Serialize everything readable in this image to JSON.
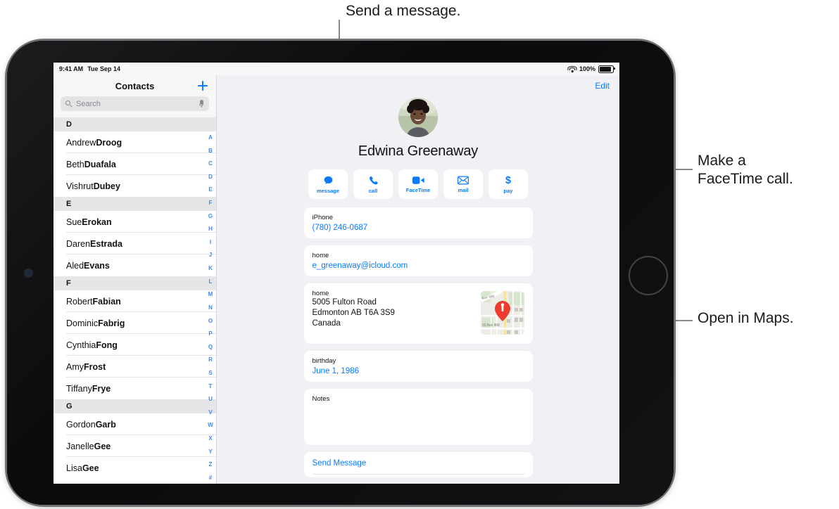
{
  "callouts": [
    {
      "id": "message",
      "text": "Send a message."
    },
    {
      "id": "facetime",
      "text": "Make a\nFaceTime call."
    },
    {
      "id": "maps",
      "text": "Open in Maps."
    }
  ],
  "status_bar": {
    "time": "9:41 AM",
    "date": "Tue Sep 14",
    "wifi_icon": "wifi-icon",
    "battery_percent": "100%",
    "battery_icon": "battery-icon"
  },
  "sidebar": {
    "title": "Contacts",
    "add_button_icon": "plus-icon",
    "search": {
      "placeholder": "Search",
      "value": "",
      "search_icon": "search-icon",
      "dictation_icon": "microphone-icon"
    },
    "sections": [
      {
        "letter": "D",
        "contacts": [
          {
            "first": "Andrew ",
            "last": "Droog"
          },
          {
            "first": "Beth ",
            "last": "Duafala"
          },
          {
            "first": "Vishrut ",
            "last": "Dubey"
          }
        ]
      },
      {
        "letter": "E",
        "contacts": [
          {
            "first": "Sue ",
            "last": "Erokan"
          },
          {
            "first": "Daren ",
            "last": "Estrada"
          },
          {
            "first": "Aled ",
            "last": "Evans"
          }
        ]
      },
      {
        "letter": "F",
        "contacts": [
          {
            "first": "Robert ",
            "last": "Fabian"
          },
          {
            "first": "Dominic ",
            "last": "Fabrig"
          },
          {
            "first": "Cynthia ",
            "last": "Fong"
          },
          {
            "first": "Amy ",
            "last": "Frost"
          },
          {
            "first": "Tiffany ",
            "last": "Frye"
          }
        ]
      },
      {
        "letter": "G",
        "contacts": [
          {
            "first": "Gordon ",
            "last": "Garb"
          },
          {
            "first": "Janelle ",
            "last": "Gee"
          },
          {
            "first": "Lisa ",
            "last": "Gee"
          }
        ]
      }
    ],
    "index_letters": [
      "A",
      "B",
      "C",
      "D",
      "E",
      "F",
      "G",
      "H",
      "I",
      "J",
      "K",
      "L",
      "M",
      "N",
      "O",
      "P",
      "Q",
      "R",
      "S",
      "T",
      "U",
      "V",
      "W",
      "X",
      "Y",
      "Z",
      "#"
    ]
  },
  "detail": {
    "edit_label": "Edit",
    "avatar_name": "contact-photo",
    "name": "Edwina Greenaway",
    "actions": [
      {
        "label": "message",
        "icon": "message-bubble-icon"
      },
      {
        "label": "call",
        "icon": "phone-icon"
      },
      {
        "label": "FaceTime",
        "icon": "video-camera-icon"
      },
      {
        "label": "mail",
        "icon": "envelope-icon"
      },
      {
        "label": "pay",
        "icon": "dollar-sign-icon"
      }
    ],
    "fields": {
      "phone": {
        "label": "iPhone",
        "value": "(780) 246-0687"
      },
      "email": {
        "label": "home",
        "value": "e_greenaway@icloud.com"
      },
      "address": {
        "label": "home",
        "lines": [
          "5005 Fulton Road",
          "Edmonton AB T6A 3S9",
          "Canada"
        ],
        "map_icon": "map-thumbnail",
        "map_labels": [
          "Ave NW",
          "03 Ave NW"
        ]
      },
      "birthday": {
        "label": "birthday",
        "value": "June 1, 1986"
      },
      "notes": {
        "label": "Notes",
        "value": ""
      },
      "send_message": {
        "label": "Send Message"
      }
    }
  },
  "colors": {
    "accent_blue": "#0a7aff",
    "index_blue": "#3b86f7",
    "detail_bg": "#f1f1f5",
    "section_header_bg": "#e6e6e8",
    "pin_red": "#ee3b30"
  }
}
